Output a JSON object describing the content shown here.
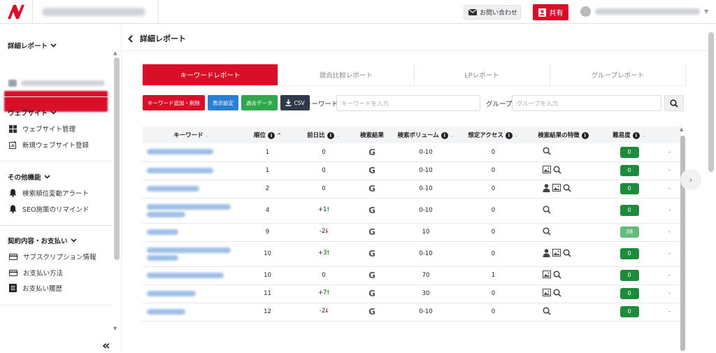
{
  "header": {
    "contact_label": "お問い合わせ",
    "share_label": "共有"
  },
  "sidebar": {
    "sections": [
      {
        "title": "詳細レポート"
      },
      {
        "title": "ウェブサイト",
        "items": [
          {
            "label": "ウェブサイト管理"
          },
          {
            "label": "新規ウェブサイト登録"
          }
        ]
      },
      {
        "title": "その他機能",
        "items": [
          {
            "label": "検索順位変動アラート"
          },
          {
            "label": "SEO施策のリマインド"
          }
        ]
      },
      {
        "title": "契約内容・お支払い",
        "items": [
          {
            "label": "サブスクリプション情報"
          },
          {
            "label": "お支払い方法"
          },
          {
            "label": "お支払い履歴"
          }
        ]
      }
    ],
    "collapse_label": "«"
  },
  "main": {
    "title": "詳細レポート",
    "tabs": [
      {
        "label": "キーワードレポート",
        "active": true
      },
      {
        "label": "競合比較レポート",
        "active": false
      },
      {
        "label": "LPレポート",
        "active": false
      },
      {
        "label": "グループレポート",
        "active": false
      }
    ],
    "toolbar": {
      "add_delete": "キーワード追加・削除",
      "display_settings": "表示設定",
      "past_data": "過去データ",
      "csv": "CSV",
      "keyword_label": "キーワード",
      "keyword_placeholder": "キーワードを入力",
      "group_label": "グループ",
      "group_placeholder": "グループを入力"
    },
    "table": {
      "headers": [
        "キーワード",
        "順位",
        "前日比",
        "検索結果",
        "検索ボリューム",
        "想定アクセス",
        "検索結果の特徴",
        "難易度"
      ],
      "rows": [
        {
          "rank": "1",
          "change": "0",
          "dir": "",
          "serp": "G",
          "volume": "0-10",
          "access": "0",
          "features": [
            "search"
          ],
          "difficulty": "0",
          "extra": "-"
        },
        {
          "rank": "1",
          "change": "0",
          "dir": "",
          "serp": "G",
          "volume": "0-10",
          "access": "0",
          "features": [
            "image",
            "search"
          ],
          "difficulty": "0",
          "extra": "-"
        },
        {
          "rank": "2",
          "change": "0",
          "dir": "",
          "serp": "G",
          "volume": "0-10",
          "access": "0",
          "features": [
            "person",
            "image",
            "search"
          ],
          "difficulty": "0",
          "extra": "-"
        },
        {
          "rank": "4",
          "change": "+1",
          "dir": "up",
          "serp": "G",
          "volume": "0-10",
          "access": "0",
          "features": [
            "search"
          ],
          "difficulty": "0",
          "extra": "-"
        },
        {
          "rank": "9",
          "change": "-2",
          "dir": "down",
          "serp": "G",
          "volume": "10",
          "access": "0",
          "features": [
            "search"
          ],
          "difficulty": "38",
          "extra": "-"
        },
        {
          "rank": "10",
          "change": "+3",
          "dir": "up",
          "serp": "G",
          "volume": "0-10",
          "access": "0",
          "features": [
            "person",
            "image",
            "search"
          ],
          "difficulty": "0",
          "extra": "-"
        },
        {
          "rank": "10",
          "change": "0",
          "dir": "",
          "serp": "G",
          "volume": "70",
          "access": "1",
          "features": [
            "image",
            "search"
          ],
          "difficulty": "0",
          "extra": "-"
        },
        {
          "rank": "11",
          "change": "+7",
          "dir": "up",
          "serp": "G",
          "volume": "30",
          "access": "0",
          "features": [
            "image",
            "search"
          ],
          "difficulty": "0",
          "extra": "-"
        },
        {
          "rank": "12",
          "change": "-2",
          "dir": "down",
          "serp": "G",
          "volume": "0-10",
          "access": "0",
          "features": [
            "search"
          ],
          "difficulty": "0",
          "extra": "-"
        }
      ]
    }
  },
  "colors": {
    "brand_red": "#d90f2a",
    "badge_green": "#1e8a3c",
    "badge_light_green": "#68b97c",
    "up_green": "#3aaa3a",
    "down_red": "#d41a2a"
  }
}
